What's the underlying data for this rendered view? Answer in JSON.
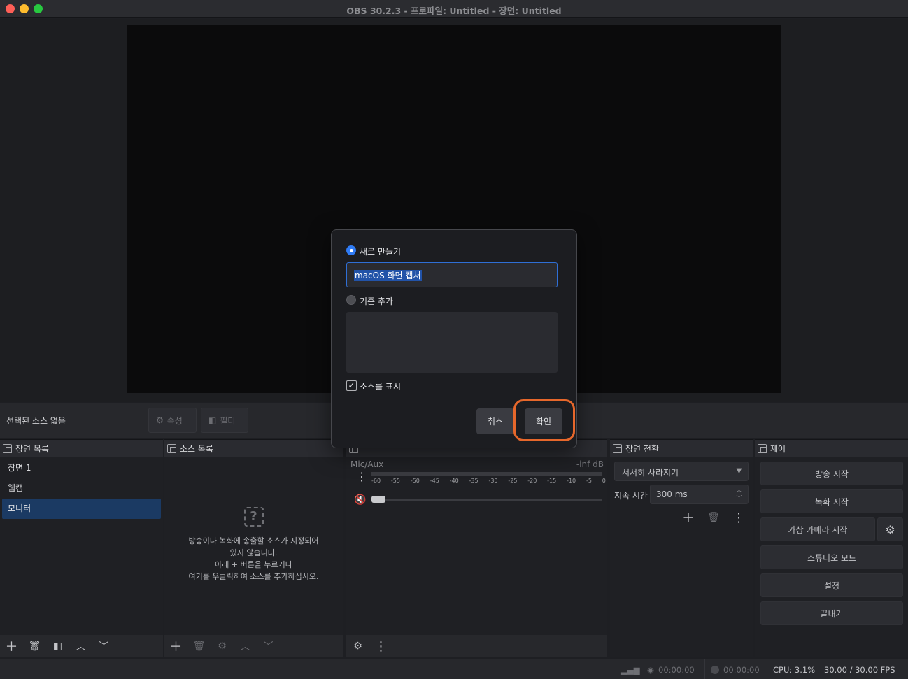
{
  "window": {
    "title": "OBS 30.2.3 - 프로파일: Untitled - 장면: Untitled"
  },
  "context": {
    "no_source": "선택된 소스 없음",
    "properties": "속성",
    "filters": "필터"
  },
  "docks": {
    "scenes": {
      "title": "장면 목록",
      "items": [
        "장면 1",
        "웹캠",
        "모니터"
      ],
      "selected": "모니터"
    },
    "sources": {
      "title": "소스 목록",
      "empty_lines": [
        "방송이나 녹화에 송출할 소스가 지정되어",
        "있지 않습니다.",
        "아래 + 버튼을 누르거나",
        "여기를 우클릭하여 소스를 추가하십시오."
      ]
    },
    "mixer": {
      "track_name": "Mic/Aux",
      "db": "-inf dB",
      "scale": [
        "-60",
        "-55",
        "-50",
        "-45",
        "-40",
        "-35",
        "-30",
        "-25",
        "-20",
        "-15",
        "-10",
        "-5",
        "0"
      ]
    },
    "transitions": {
      "title": "장면 전환",
      "selected": "서서히 사라지기",
      "duration_label": "지속 시간",
      "duration_value": "300 ms"
    },
    "controls": {
      "title": "제어",
      "stream": "방송 시작",
      "record": "녹화 시작",
      "virtual_cam": "가상 카메라 시작",
      "studio": "스튜디오 모드",
      "settings": "설정",
      "exit": "끝내기"
    }
  },
  "status": {
    "stream_time": "00:00:00",
    "rec_time": "00:00:00",
    "cpu": "CPU: 3.1%",
    "fps": "30.00 / 30.00 FPS"
  },
  "dialog": {
    "create_new_label": "새로 만들기",
    "name_value": "macOS 화면 캡처",
    "add_existing_label": "기존 추가",
    "show_source_label": "소스를 표시",
    "show_source_checked": true,
    "cancel": "취소",
    "ok": "확인"
  }
}
